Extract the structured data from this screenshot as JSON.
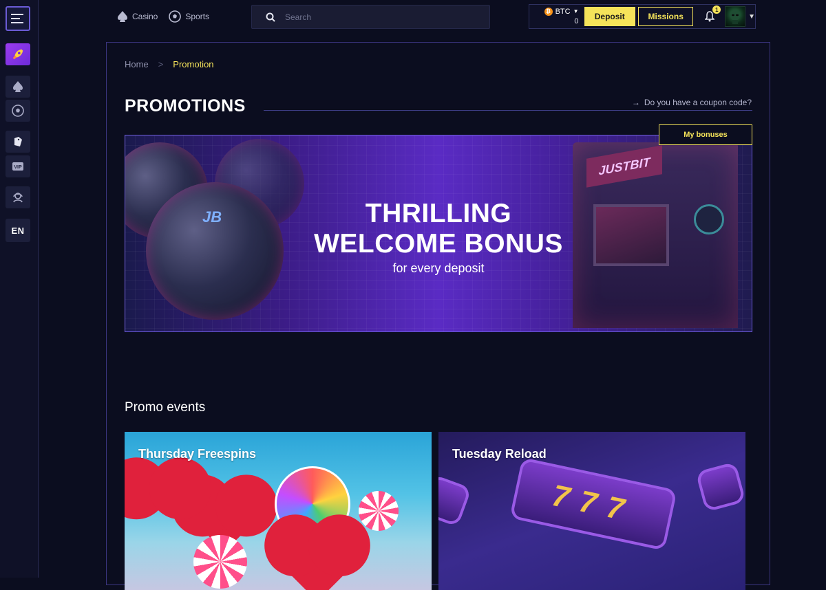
{
  "sidebar": {
    "lang": "EN"
  },
  "topnav": {
    "casino": "Casino",
    "sports": "Sports"
  },
  "search": {
    "placeholder": "Search"
  },
  "account": {
    "currency": "BTC",
    "balance": "0",
    "deposit": "Deposit",
    "missions": "Missions",
    "notifications": "1"
  },
  "breadcrumb": {
    "home": "Home",
    "sep": ">",
    "current": "Promotion"
  },
  "page": {
    "title": "PROMOTIONS",
    "coupon": "Do you have a coupon code?",
    "my_bonuses": "My bonuses"
  },
  "banner": {
    "line1": "THRILLING",
    "line2": "WELCOME BONUS",
    "sub": "for every deposit",
    "sign": "JUSTBIT",
    "ball_logo": "JB"
  },
  "promo": {
    "section_title": "Promo events",
    "cards": [
      {
        "title": "Thursday Freespins"
      },
      {
        "title": "Tuesday Reload",
        "reel": "777"
      }
    ]
  },
  "colors": {
    "accent": "#f5e35a",
    "brand": "#6d2bd9",
    "bg": "#0b0d1f"
  }
}
